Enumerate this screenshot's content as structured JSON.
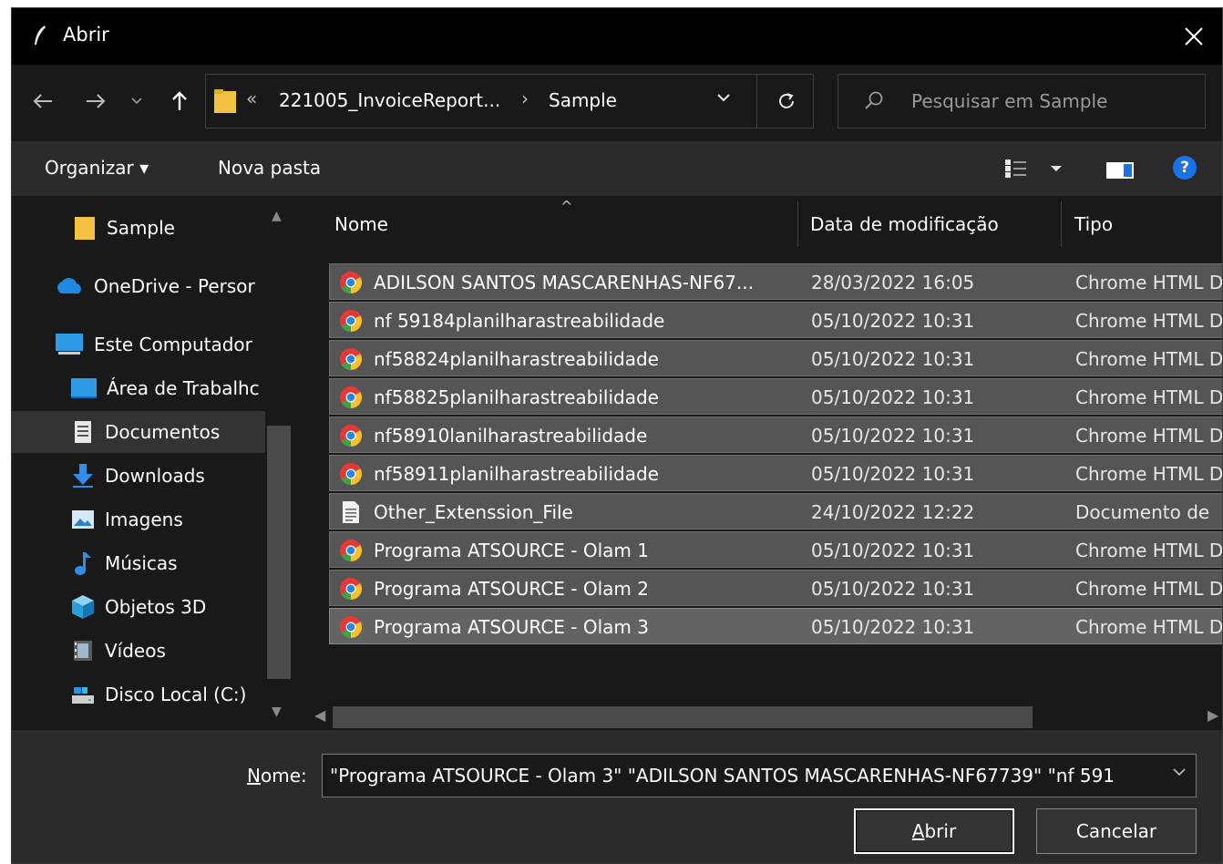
{
  "window": {
    "title": "Abrir",
    "close_glyph": "✕"
  },
  "nav": {
    "back_glyph": "←",
    "forward_glyph": "→",
    "recent_glyph": "˅",
    "up_glyph": "↑"
  },
  "address": {
    "overflow_glyph": "«",
    "segment1": "221005_InvoiceReport...",
    "separator": "›",
    "segment2": "Sample",
    "refresh_glyph": "↻"
  },
  "search": {
    "placeholder": "Pesquisar em Sample"
  },
  "toolbar": {
    "organize": "Organizar ▾",
    "new_folder": "Nova pasta",
    "help": "?"
  },
  "sidebar": {
    "items": [
      {
        "label": "Sample",
        "icon": "folder-icon"
      },
      {
        "label": "OneDrive - Persor",
        "icon": "cloud-icon"
      },
      {
        "label": "Este Computador",
        "icon": "computer-icon"
      },
      {
        "label": "Área de Trabalhc",
        "icon": "desktop-icon"
      },
      {
        "label": "Documentos",
        "icon": "documents-icon",
        "selected": true
      },
      {
        "label": "Downloads",
        "icon": "downloads-icon"
      },
      {
        "label": "Imagens",
        "icon": "pictures-icon"
      },
      {
        "label": "Músicas",
        "icon": "music-icon"
      },
      {
        "label": "Objetos 3D",
        "icon": "cube-icon"
      },
      {
        "label": "Vídeos",
        "icon": "video-icon"
      },
      {
        "label": "Disco Local (C:)",
        "icon": "drive-icon"
      }
    ]
  },
  "columns": {
    "name": "Nome",
    "date": "Data de modificação",
    "type": "Tipo"
  },
  "files": [
    {
      "name": "ADILSON SANTOS MASCARENHAS-NF67...",
      "date": "28/03/2022 16:05",
      "type": "Chrome HTML D",
      "icon": "chrome-icon"
    },
    {
      "name": "nf 59184planilharastreabilidade",
      "date": "05/10/2022 10:31",
      "type": "Chrome HTML D",
      "icon": "chrome-icon"
    },
    {
      "name": "nf58824planilharastreabilidade",
      "date": "05/10/2022 10:31",
      "type": "Chrome HTML D",
      "icon": "chrome-icon"
    },
    {
      "name": "nf58825planilharastreabilidade",
      "date": "05/10/2022 10:31",
      "type": "Chrome HTML D",
      "icon": "chrome-icon"
    },
    {
      "name": "nf58910lanilharastreabilidade",
      "date": "05/10/2022 10:31",
      "type": "Chrome HTML D",
      "icon": "chrome-icon"
    },
    {
      "name": "nf58911planilharastreabilidade",
      "date": "05/10/2022 10:31",
      "type": "Chrome HTML D",
      "icon": "chrome-icon"
    },
    {
      "name": "Other_Extenssion_File",
      "date": "24/10/2022 12:22",
      "type": "Documento de",
      "icon": "text-file-icon"
    },
    {
      "name": "Programa ATSOURCE - Olam 1",
      "date": "05/10/2022 10:31",
      "type": "Chrome HTML D",
      "icon": "chrome-icon"
    },
    {
      "name": "Programa ATSOURCE - Olam 2",
      "date": "05/10/2022 10:31",
      "type": "Chrome HTML D",
      "icon": "chrome-icon"
    },
    {
      "name": "Programa ATSOURCE - Olam 3",
      "date": "05/10/2022 10:31",
      "type": "Chrome HTML D",
      "icon": "chrome-icon"
    }
  ],
  "filename": {
    "label_prefix": "N",
    "label_rest": "ome:",
    "value": "\"Programa ATSOURCE - Olam 3\" \"ADILSON SANTOS MASCARENHAS-NF67739\" \"nf 591"
  },
  "buttons": {
    "open_prefix": "A",
    "open_rest": "brir",
    "cancel": "Cancelar"
  }
}
